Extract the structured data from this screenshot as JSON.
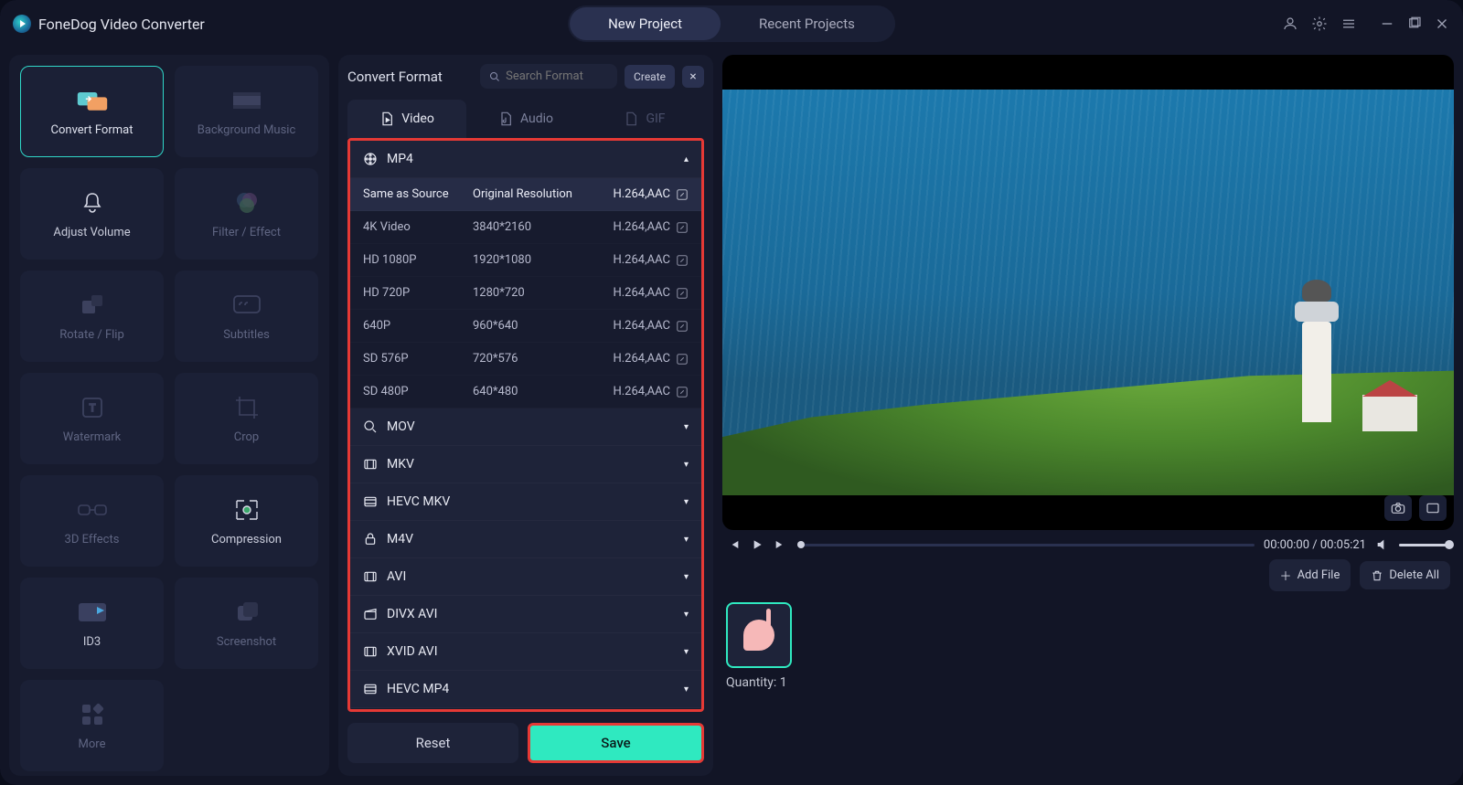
{
  "app": {
    "title": "FoneDog Video Converter"
  },
  "header": {
    "tabs": {
      "new_project": "New Project",
      "recent_projects": "Recent Projects"
    }
  },
  "sidebar": {
    "convert_format": "Convert Format",
    "background_music": "Background Music",
    "adjust_volume": "Adjust Volume",
    "filter_effect": "Filter / Effect",
    "rotate_flip": "Rotate / Flip",
    "subtitles": "Subtitles",
    "watermark": "Watermark",
    "crop": "Crop",
    "three_d": "3D Effects",
    "compression": "Compression",
    "id3": "ID3",
    "screenshot": "Screenshot",
    "more": "More"
  },
  "convert_panel": {
    "title": "Convert Format",
    "search_placeholder": "Search Format",
    "create": "Create",
    "tabs": {
      "video": "Video",
      "audio": "Audio",
      "gif": "GIF"
    },
    "groups": {
      "mp4": "MP4",
      "mov": "MOV",
      "mkv": "MKV",
      "hevc_mkv": "HEVC MKV",
      "m4v": "M4V",
      "avi": "AVI",
      "divx_avi": "DIVX AVI",
      "xvid_avi": "XVID AVI",
      "hevc_mp4": "HEVC MP4"
    },
    "mp4_presets": [
      {
        "name": "Same as Source",
        "res": "Original Resolution",
        "codec": "H.264,AAC"
      },
      {
        "name": "4K Video",
        "res": "3840*2160",
        "codec": "H.264,AAC"
      },
      {
        "name": "HD 1080P",
        "res": "1920*1080",
        "codec": "H.264,AAC"
      },
      {
        "name": "HD 720P",
        "res": "1280*720",
        "codec": "H.264,AAC"
      },
      {
        "name": "640P",
        "res": "960*640",
        "codec": "H.264,AAC"
      },
      {
        "name": "SD 576P",
        "res": "720*576",
        "codec": "H.264,AAC"
      },
      {
        "name": "SD 480P",
        "res": "640*480",
        "codec": "H.264,AAC"
      }
    ],
    "buttons": {
      "reset": "Reset",
      "save": "Save"
    }
  },
  "player": {
    "time": "00:00:00 / 00:05:21"
  },
  "filebar": {
    "add_file": "Add File",
    "delete_all": "Delete All"
  },
  "footer": {
    "quantity_label": "Quantity: 1"
  }
}
